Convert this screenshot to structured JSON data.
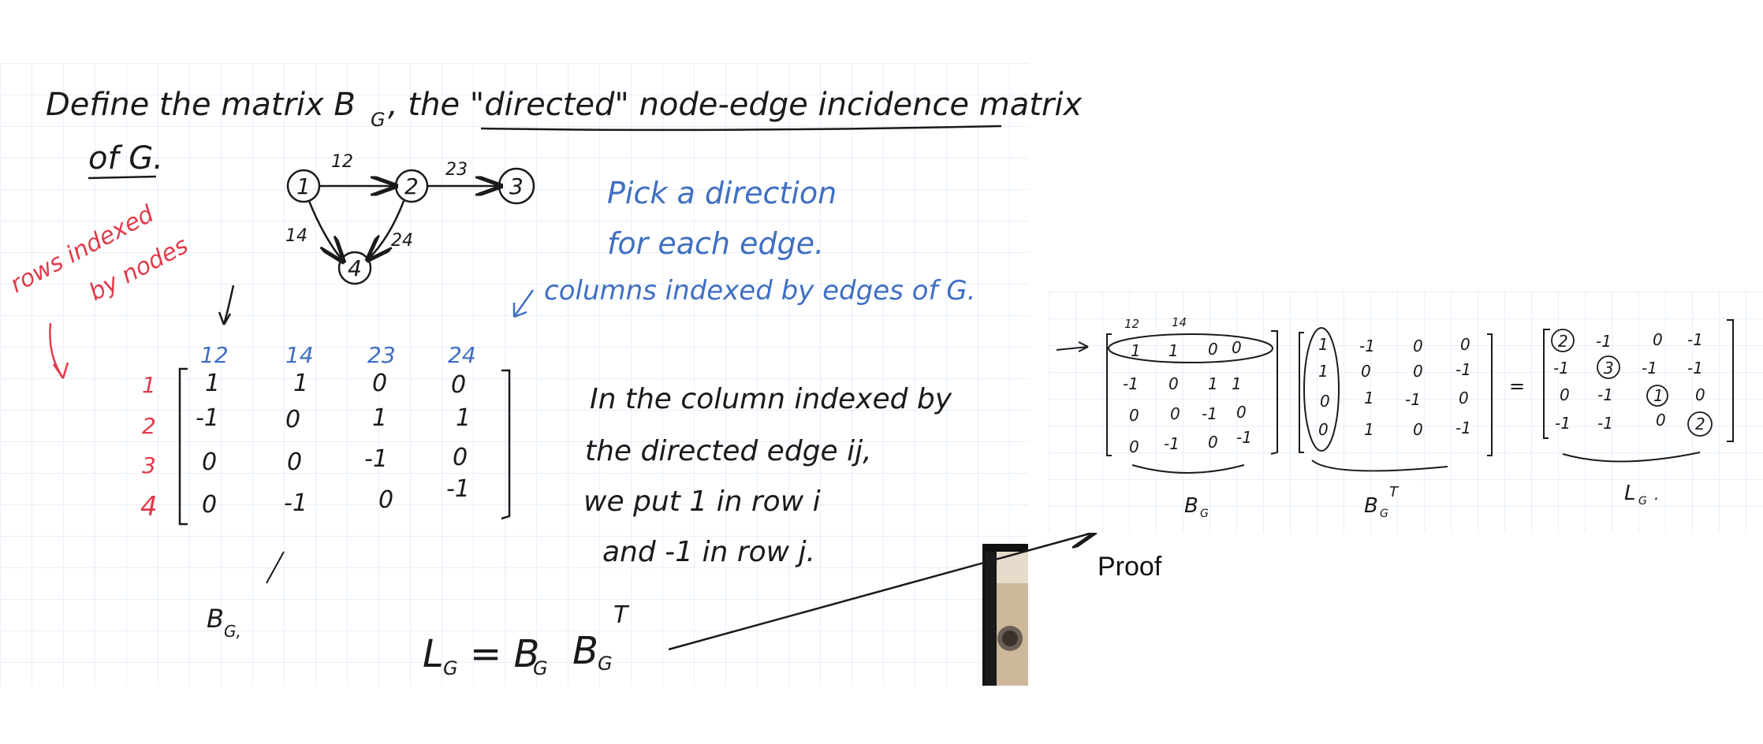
{
  "colors": {
    "ink": "#1a1a1a",
    "blue": "#3f6fc2",
    "red": "#e23b4a",
    "grid": "#cfe0f4",
    "gridMajor": "#b6cde9"
  },
  "left_note": {
    "line1": "Define the matrix B",
    "sub_G": "G",
    "line1b": ", the \"directed\" node-edge incidence matrix",
    "line2": "of G.",
    "graph": {
      "nodes": [
        "1",
        "2",
        "3",
        "4"
      ],
      "edges": [
        "12",
        "23",
        "14",
        "24"
      ]
    },
    "blue_note1": "Pick a direction",
    "blue_note2": "for each edge.",
    "blue_note3": "columns indexed by edges of G.",
    "red_note1": "rows indexed",
    "red_note2": "by nodes",
    "col_headers": [
      "12",
      "14",
      "23",
      "24"
    ],
    "row_headers": [
      "1",
      "2",
      "3",
      "4"
    ],
    "matrix": [
      [
        "1",
        "1",
        "0",
        "0"
      ],
      [
        "-1",
        "0",
        "1",
        "1"
      ],
      [
        "0",
        "0",
        "-1",
        "0"
      ],
      [
        "0",
        "-1",
        "0",
        "-1"
      ]
    ],
    "bg_label": "B",
    "bg_label_sub": "G,",
    "rule1": "In the column indexed by",
    "rule2": "the directed edge ij,",
    "rule3": "we put 1 in row i",
    "rule4": "and -1 in row j.",
    "formula_L": "L",
    "formula_eq": "= B",
    "formula_B2": "B",
    "formula_sub": "G",
    "formula_T": "T"
  },
  "right_note": {
    "col_headers": [
      "12",
      "14"
    ],
    "B": [
      [
        "1",
        "1",
        "0",
        "0"
      ],
      [
        "-1",
        "0",
        "1",
        "1"
      ],
      [
        "0",
        "0",
        "-1",
        "0"
      ],
      [
        "0",
        "-1",
        "0",
        "-1"
      ]
    ],
    "BT": [
      [
        "1",
        "-1",
        "0",
        "0"
      ],
      [
        "1",
        "0",
        "0",
        "-1"
      ],
      [
        "0",
        "1",
        "-1",
        "0"
      ],
      [
        "0",
        "1",
        "0",
        "-1"
      ]
    ],
    "L": [
      [
        "2",
        "-1",
        "0",
        "-1"
      ],
      [
        "-1",
        "3",
        "-1",
        "-1"
      ],
      [
        "0",
        "-1",
        "1",
        "0"
      ],
      [
        "-1",
        "-1",
        "0",
        "2"
      ]
    ],
    "eq": "=",
    "label_B": "B",
    "label_BT": "B",
    "label_T": "T",
    "label_L": "L",
    "sub_G": "G",
    "dot": "."
  },
  "proof_label": "Proof"
}
